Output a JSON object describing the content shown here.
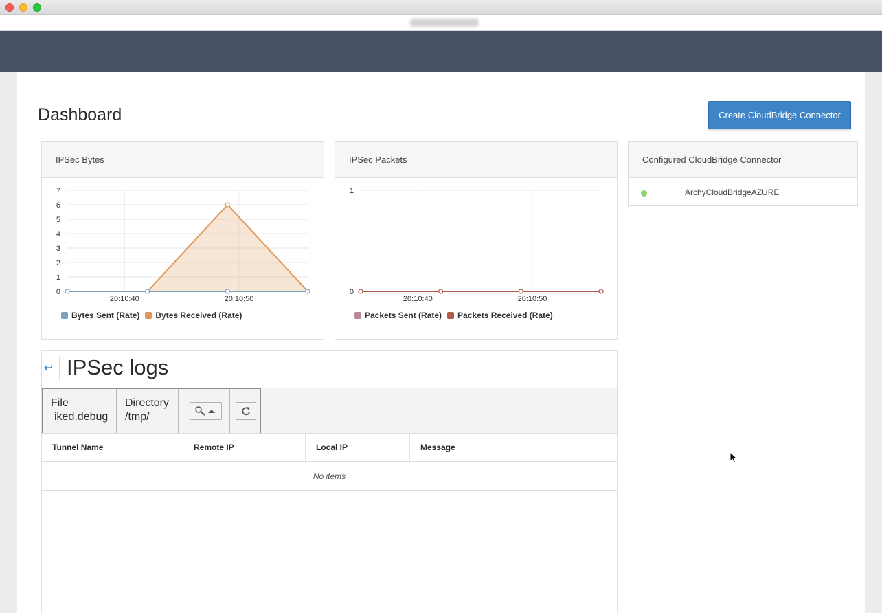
{
  "page": {
    "title": "Dashboard"
  },
  "actions": {
    "create_label": "Create CloudBridge Connector"
  },
  "bytes_panel": {
    "title": "IPSec Bytes",
    "legend": [
      {
        "label": "Bytes Sent (Rate)",
        "color": "#7ca3c4"
      },
      {
        "label": "Bytes Received (Rate)",
        "color": "#e0985a"
      }
    ]
  },
  "packets_panel": {
    "title": "IPSec Packets",
    "legend": [
      {
        "label": "Packets Sent (Rate)",
        "color": "#b38a9c"
      },
      {
        "label": "Packets Received (Rate)",
        "color": "#b05a48"
      }
    ]
  },
  "connector_panel": {
    "title": "Configured CloudBridge Connector",
    "connectors": [
      {
        "name": "ArchyCloudBridgeAZURE",
        "status_color": "#8fd16c"
      }
    ]
  },
  "logs": {
    "title": "IPSec logs",
    "file_label": "File",
    "file_value": "iked.debug",
    "directory_label": "Directory",
    "directory_value": "/tmp/",
    "columns": [
      "Tunnel Name",
      "Remote IP",
      "Local IP",
      "Message"
    ],
    "empty_text": "No items"
  },
  "chart_data": [
    {
      "type": "area",
      "x": [
        "20:10:35",
        "20:10:42",
        "20:10:49",
        "20:10:56"
      ],
      "xticks": [
        "20:10:40",
        "20:10:50"
      ],
      "ylim": [
        0,
        7
      ],
      "yticks": [
        0,
        1,
        2,
        3,
        4,
        5,
        6,
        7
      ],
      "grid": true,
      "legend_position": "bottom",
      "series": [
        {
          "name": "Bytes Sent (Rate)",
          "values": [
            0,
            0,
            0,
            0
          ],
          "color": "#7ca3c4"
        },
        {
          "name": "Bytes Received (Rate)",
          "values": [
            0,
            0,
            6,
            0
          ],
          "color": "#e0985a"
        }
      ]
    },
    {
      "type": "line",
      "x": [
        "20:10:35",
        "20:10:42",
        "20:10:49",
        "20:10:56"
      ],
      "xticks": [
        "20:10:40",
        "20:10:50"
      ],
      "ylim": [
        0,
        1
      ],
      "yticks": [
        0,
        1
      ],
      "grid": true,
      "legend_position": "bottom",
      "series": [
        {
          "name": "Packets Sent (Rate)",
          "values": [
            0,
            0,
            0,
            0
          ],
          "color": "#b38a9c"
        },
        {
          "name": "Packets Received (Rate)",
          "values": [
            0,
            0,
            0,
            0
          ],
          "color": "#b05a48"
        }
      ]
    }
  ]
}
